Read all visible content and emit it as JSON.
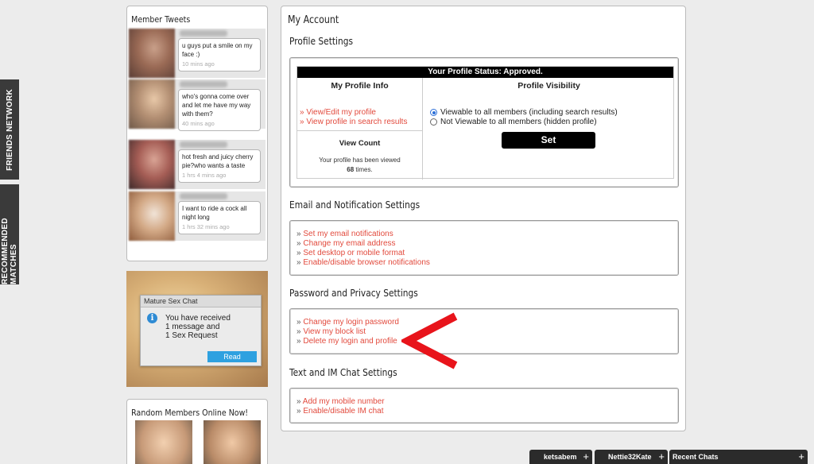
{
  "side_tabs": {
    "friends": "FRIENDS NETWORK",
    "matches": "RECOMMENDED MATCHES"
  },
  "tweets": {
    "title": "Member Tweets",
    "items": [
      {
        "text": "u guys put a smile on my face :)",
        "ago": "10 mins ago"
      },
      {
        "text": "who's gonna come over and let me have my way with them?",
        "ago": "40 mins ago"
      },
      {
        "text": "hot fresh and juicy cherry pie?who wants a taste",
        "ago": "1 hrs 4 mins ago"
      },
      {
        "text": "I want to ride a cock all night long",
        "ago": "1 hrs 32 mins ago"
      }
    ]
  },
  "ad": {
    "title": "Mature Sex Chat",
    "line1": "You have received",
    "line2": "1 message and",
    "line3": "1 Sex Request",
    "button": "Read"
  },
  "random": {
    "title": "Random Members Online Now!"
  },
  "account": {
    "title": "My Account",
    "profile": {
      "heading": "Profile Settings",
      "status": "Your Profile Status: Approved.",
      "info_heading": "My Profile Info",
      "links": [
        "View/Edit my profile",
        "View profile in search results"
      ],
      "view_count_heading": "View Count",
      "view_text": "Your profile has been viewed",
      "view_count": "68",
      "view_suffix": "times.",
      "visibility_heading": "Profile Visibility",
      "option1": "Viewable to all members (including search results)",
      "option2": "Not Viewable to all members (hidden profile)",
      "set_button": "Set"
    },
    "email": {
      "heading": "Email and Notification Settings",
      "links": [
        "Set my email notifications",
        "Change my email address",
        "Set desktop or mobile format",
        "Enable/disable browser notifications"
      ]
    },
    "privacy": {
      "heading": "Password and Privacy Settings",
      "links": [
        "Change my login password",
        "View my block list",
        "Delete my login and profile"
      ]
    },
    "im": {
      "heading": "Text and IM Chat Settings",
      "links": [
        "Add my mobile number",
        "Enable/disable IM chat"
      ]
    }
  },
  "chat_bar": {
    "tabs": [
      "ketsabem",
      "Nettie32Kate",
      "Recent Chats"
    ],
    "plus": "+"
  },
  "colors": {
    "link": "#e24a3d",
    "arrow": "#e8141b",
    "status_bar": "#000000"
  },
  "link_prefix": "»"
}
